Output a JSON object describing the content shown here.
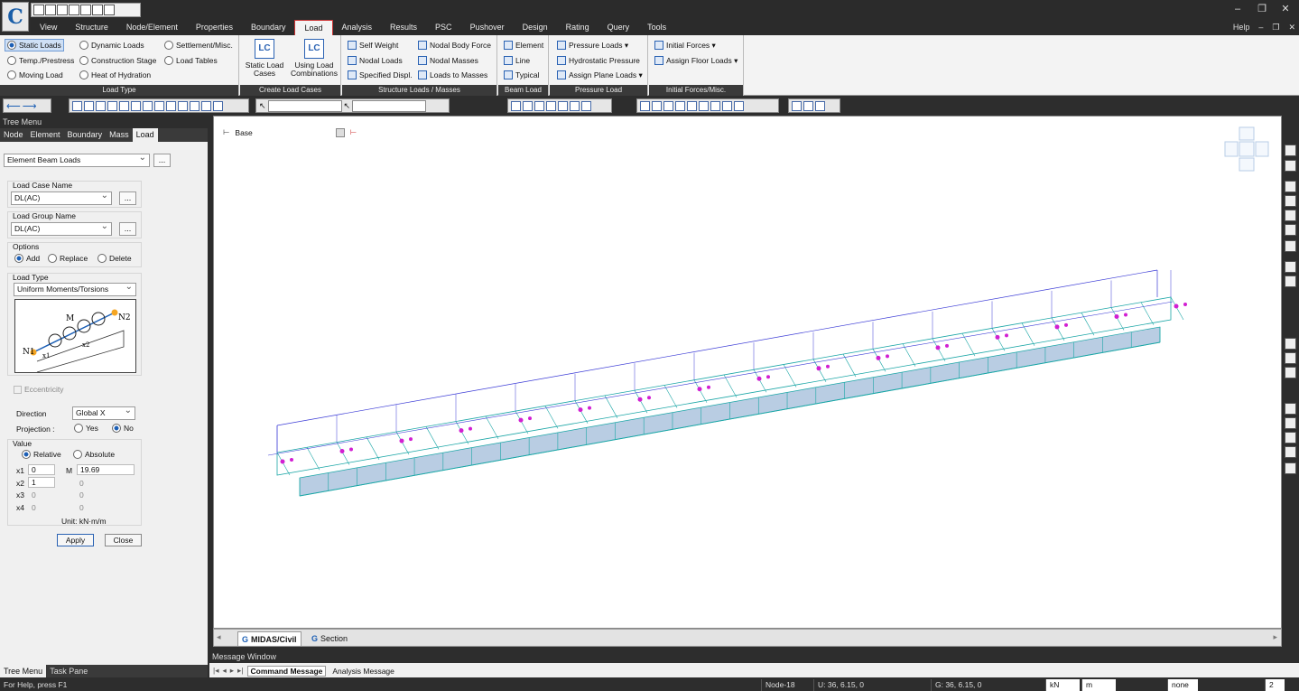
{
  "app": {
    "logo": "C"
  },
  "window": {
    "minimize": "–",
    "restore": "❐",
    "close": "✕"
  },
  "menu_tabs": [
    "View",
    "Structure",
    "Node/Element",
    "Properties",
    "Boundary",
    "Load",
    "Analysis",
    "Results",
    "PSC",
    "Pushover",
    "Design",
    "Rating",
    "Query",
    "Tools"
  ],
  "active_tab": "Load",
  "help": "Help",
  "ribbon": {
    "load_type": {
      "label": "Load Type",
      "items": [
        "Static Loads",
        "Temp./Prestress",
        "Moving Load",
        "Dynamic Loads",
        "Construction Stage",
        "Heat of Hydration",
        "Settlement/Misc.",
        "Load Tables"
      ]
    },
    "create_load_cases": {
      "label": "Create Load Cases",
      "static": "Static Load\nCases",
      "combos": "Using Load\nCombinations",
      "static_icon": "LC",
      "combos_icon": "LC"
    },
    "structure_loads": {
      "label": "Structure Loads / Masses",
      "items": [
        "Self Weight",
        "Nodal Loads",
        "Specified Displ.",
        "Nodal Body Force",
        "Nodal Masses",
        "Loads to Masses"
      ]
    },
    "beam_load": {
      "label": "Beam Load",
      "items": [
        "Element",
        "Line",
        "Typical"
      ]
    },
    "pressure_load": {
      "label": "Pressure Load",
      "items": [
        "Pressure Loads ▾",
        "Hydrostatic Pressure",
        "Assign Plane Loads ▾"
      ]
    },
    "initial_forces": {
      "label": "Initial Forces/Misc.",
      "items": [
        "Initial Forces ▾",
        "Assign Floor Loads ▾"
      ]
    }
  },
  "tree": {
    "header": "Tree Menu",
    "tabs": [
      "Node",
      "Element",
      "Boundary",
      "Mass",
      "Load"
    ],
    "active_tab": "Load",
    "function": "Element Beam Loads",
    "load_case_label": "Load Case Name",
    "load_case": "DL(AC)",
    "load_group_label": "Load Group Name",
    "load_group": "DL(AC)",
    "options_label": "Options",
    "options": [
      "Add",
      "Replace",
      "Delete"
    ],
    "load_type_label": "Load Type",
    "load_type": "Uniform Moments/Torsions",
    "diagram": {
      "n1": "N1",
      "n2": "N2",
      "m": "M",
      "x1": "x1",
      "x2": "x2"
    },
    "eccentricity": "Eccentricity",
    "direction_label": "Direction",
    "direction": "Global X",
    "projection_label": "Projection :",
    "projection": [
      "Yes",
      "No"
    ],
    "value_label": "Value",
    "value_mode": [
      "Relative",
      "Absolute"
    ],
    "rows": [
      {
        "x": "x1",
        "xv": "0",
        "m": "M",
        "mv": "19.69"
      },
      {
        "x": "x2",
        "xv": "1",
        "m": "",
        "mv": "0"
      },
      {
        "x": "x3",
        "xv": "0",
        "m": "",
        "mv": "0"
      },
      {
        "x": "x4",
        "xv": "0",
        "m": "",
        "mv": "0"
      }
    ],
    "unit": "Unit:  kN·m/m",
    "apply": "Apply",
    "close": "Close",
    "bottom_tabs": [
      "Tree Menu",
      "Task Pane"
    ]
  },
  "view": {
    "base": "Base",
    "tabs": [
      "MIDAS/Civil",
      "Section"
    ]
  },
  "message": {
    "title": "Message Window",
    "tabs": [
      "Command Message",
      "Analysis Message"
    ]
  },
  "status": {
    "help": "For Help, press F1",
    "node": "Node-18",
    "u": "U: 36, 6.15, 0",
    "g": "G: 36, 6.15, 0",
    "force": "kN",
    "length": "m",
    "none": "none",
    "page": "2"
  },
  "colors": {
    "accent": "#1c5fb5",
    "model_cyan": "#1aa6a6",
    "load_magenta": "#d21fd2",
    "frame_blue": "#3b3bd6"
  }
}
